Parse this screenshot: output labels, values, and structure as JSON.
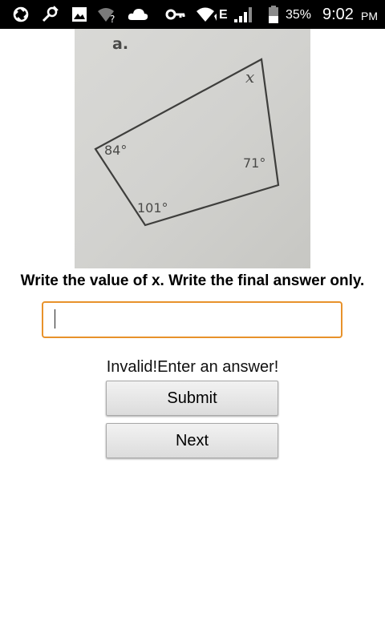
{
  "status_bar": {
    "icons": [
      "sync-icon",
      "tool-icon",
      "image-icon",
      "wifi-question-icon",
      "cloud-icon",
      "key-icon",
      "wifi-icon",
      "signal-icon",
      "battery-icon"
    ],
    "network_type": "E",
    "battery_percent": "35%",
    "time": "9:02",
    "ampm": "PM"
  },
  "photo": {
    "label": "a.",
    "angle_x": "x",
    "angle_top_left": "84°",
    "angle_right": "71°",
    "angle_bottom": "101°"
  },
  "question": {
    "text": "Write the value of x. Write the final answer only."
  },
  "answer": {
    "value": "",
    "placeholder": ""
  },
  "validation": {
    "message": "Invalid!Enter an answer!"
  },
  "buttons": {
    "submit_label": "Submit",
    "next_label": "Next"
  },
  "colors": {
    "status_bar_bg": "#000000",
    "input_focus_border": "#e8922b"
  }
}
